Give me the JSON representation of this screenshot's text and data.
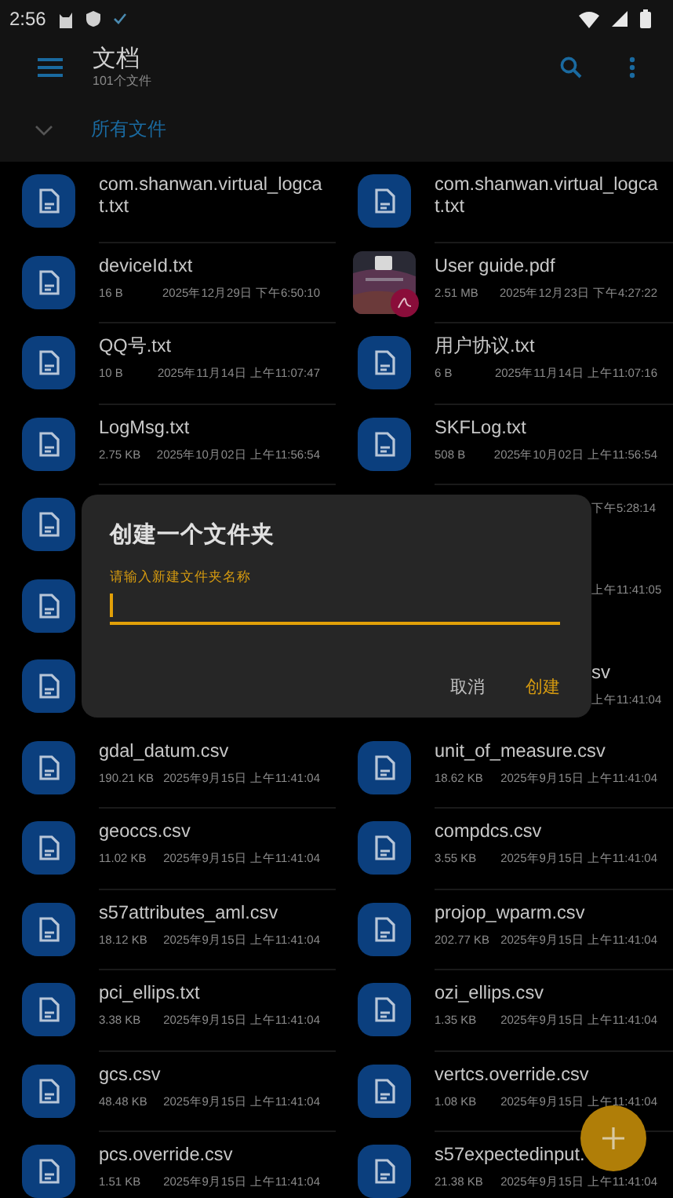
{
  "status_bar": {
    "time": "2:56"
  },
  "app_bar": {
    "title": "文档",
    "subtitle": "101个文件"
  },
  "filter": {
    "label": "所有文件"
  },
  "files": [
    {
      "kind": "file",
      "name": "com.shanwan.virtual_logcat.txt"
    },
    {
      "kind": "file",
      "name": "com.shanwan.virtual_logcat.txt"
    },
    {
      "kind": "file",
      "name": "deviceId.txt",
      "size": "16 B",
      "date": "2025年12月29日 下午6:50:10"
    },
    {
      "kind": "pdf",
      "name": "User guide.pdf",
      "size": "2.51 MB",
      "date": "2025年12月23日 下午4:27:22"
    },
    {
      "kind": "file",
      "name": "QQ号.txt",
      "size": "10 B",
      "date": "2025年11月14日 上午11:07:47"
    },
    {
      "kind": "file",
      "name": "用户协议.txt",
      "size": "6 B",
      "date": "2025年11月14日 上午11:07:16"
    },
    {
      "kind": "file",
      "name": "LogMsg.txt",
      "size": "2.75 KB",
      "date": "2025年10月02日 上午11:56:54"
    },
    {
      "kind": "file",
      "name": "SKFLog.txt",
      "size": "508 B",
      "date": "2025年10月02日 上午11:56:54"
    },
    {
      "kind": "covered"
    },
    {
      "kind": "partial",
      "date": "下午5:28:14"
    },
    {
      "kind": "covered"
    },
    {
      "kind": "partial",
      "date": "上午11:41:05"
    },
    {
      "kind": "covered"
    },
    {
      "kind": "partial",
      "name": "sv",
      "date": "上午11:41:04"
    },
    {
      "kind": "file",
      "name": "gdal_datum.csv",
      "size": "190.21 KB",
      "date": "2025年9月15日 上午11:41:04"
    },
    {
      "kind": "file",
      "name": "unit_of_measure.csv",
      "size": "18.62 KB",
      "date": "2025年9月15日 上午11:41:04"
    },
    {
      "kind": "file",
      "name": "geoccs.csv",
      "size": "11.02 KB",
      "date": "2025年9月15日 上午11:41:04"
    },
    {
      "kind": "file",
      "name": "compdcs.csv",
      "size": "3.55 KB",
      "date": "2025年9月15日 上午11:41:04"
    },
    {
      "kind": "file",
      "name": "s57attributes_aml.csv",
      "size": "18.12 KB",
      "date": "2025年9月15日 上午11:41:04"
    },
    {
      "kind": "file",
      "name": "projop_wparm.csv",
      "size": "202.77 KB",
      "date": "2025年9月15日 上午11:41:04"
    },
    {
      "kind": "file",
      "name": "pci_ellips.txt",
      "size": "3.38 KB",
      "date": "2025年9月15日 上午11:41:04"
    },
    {
      "kind": "file",
      "name": "ozi_ellips.csv",
      "size": "1.35 KB",
      "date": "2025年9月15日 上午11:41:04"
    },
    {
      "kind": "file",
      "name": "gcs.csv",
      "size": "48.48 KB",
      "date": "2025年9月15日 上午11:41:04"
    },
    {
      "kind": "file",
      "name": "vertcs.override.csv",
      "size": "1.08 KB",
      "date": "2025年9月15日 上午11:41:04"
    },
    {
      "kind": "file",
      "name": "pcs.override.csv",
      "size": "1.51 KB",
      "date": "2025年9月15日 上午11:41:04"
    },
    {
      "kind": "file",
      "name": "s57expectedinput.",
      "size": "21.38 KB",
      "date": "2025年9月15日 上午11:41:04"
    }
  ],
  "dialog": {
    "title": "创建一个文件夹",
    "field_label": "请输入新建文件夹名称",
    "buttons": [
      {
        "kind": "cancel",
        "label": "取消"
      },
      {
        "kind": "confirm",
        "label": "创建"
      }
    ]
  }
}
